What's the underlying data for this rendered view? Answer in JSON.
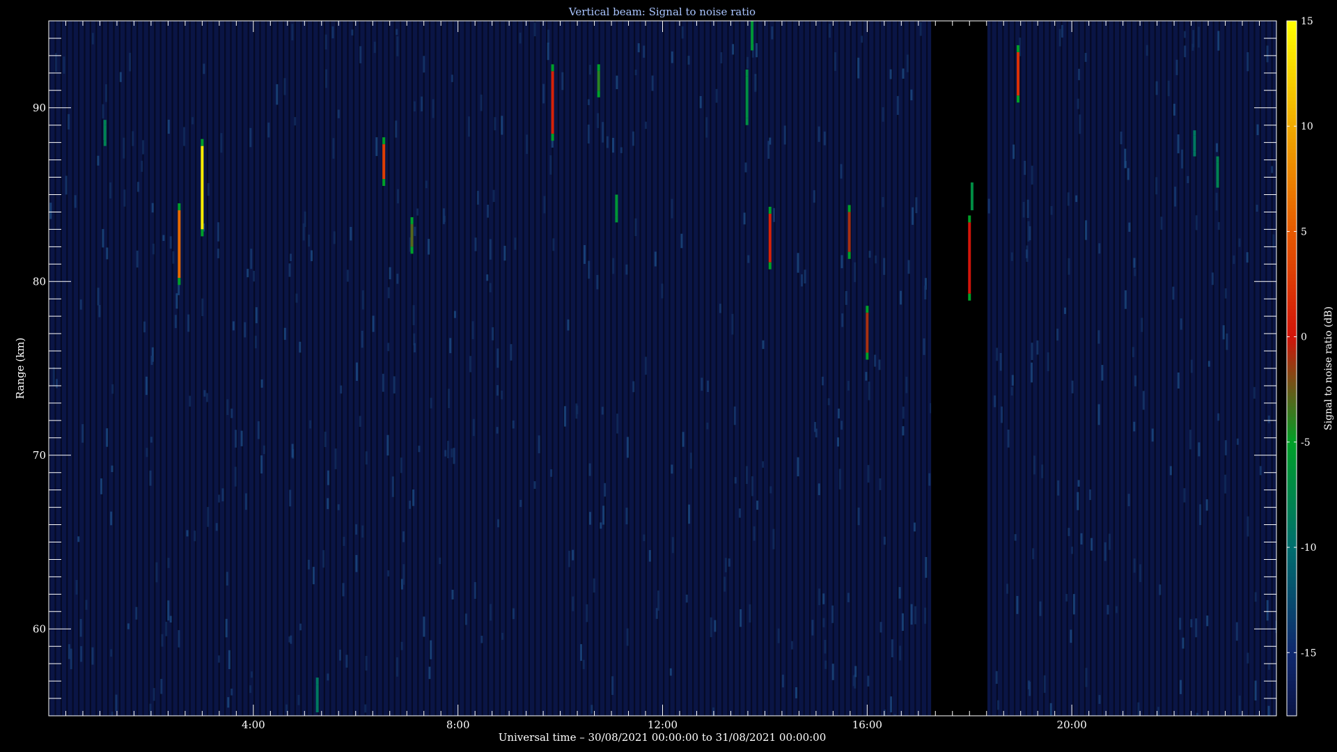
{
  "chart_data": {
    "type": "heatmap",
    "title": "Vertical beam: Signal to noise ratio",
    "xlabel": "Universal time – 30/08/2021 00:00:00 to 31/08/2021 00:00:00",
    "ylabel": "Range (km)",
    "colorbar_label": "Signal to noise ratio (dB)",
    "x_unit": "hours UT",
    "xlim": [
      0,
      24
    ],
    "ylim": [
      55,
      95
    ],
    "clim": [
      -18,
      15
    ],
    "x_ticks": [
      {
        "value": 4,
        "label": "4:00"
      },
      {
        "value": 8,
        "label": "8:00"
      },
      {
        "value": 12,
        "label": "12:00"
      },
      {
        "value": 16,
        "label": "16:00"
      },
      {
        "value": 20,
        "label": "20:00"
      }
    ],
    "y_ticks": [
      {
        "value": 60,
        "label": "60"
      },
      {
        "value": 70,
        "label": "70"
      },
      {
        "value": 80,
        "label": "80"
      },
      {
        "value": 90,
        "label": "90"
      }
    ],
    "colorbar_ticks": [
      {
        "value": 15,
        "label": "15"
      },
      {
        "value": 10,
        "label": "10"
      },
      {
        "value": 5,
        "label": "5"
      },
      {
        "value": 0,
        "label": "0"
      },
      {
        "value": -5,
        "label": "-5"
      },
      {
        "value": -10,
        "label": "-10"
      },
      {
        "value": -15,
        "label": "-15"
      }
    ],
    "background_snr": -16,
    "data_gap": {
      "x_start": 17.25,
      "x_end": 18.35
    },
    "echoes": [
      {
        "x": 1.1,
        "y_start": 87.8,
        "y_end": 89.3,
        "snr": -8
      },
      {
        "x": 2.55,
        "y_start": 79.8,
        "y_end": 84.5,
        "snr": 6
      },
      {
        "x": 3.0,
        "y_start": 82.6,
        "y_end": 88.2,
        "snr": 14
      },
      {
        "x": 5.25,
        "y_start": 55.2,
        "y_end": 57.2,
        "snr": -9
      },
      {
        "x": 6.55,
        "y_start": 85.5,
        "y_end": 88.3,
        "snr": 3
      },
      {
        "x": 7.1,
        "y_start": 81.6,
        "y_end": 83.7,
        "snr": -3
      },
      {
        "x": 9.85,
        "y_start": 88.1,
        "y_end": 92.5,
        "snr": 1
      },
      {
        "x": 10.75,
        "y_start": 90.6,
        "y_end": 92.5,
        "snr": -4
      },
      {
        "x": 11.1,
        "y_start": 83.4,
        "y_end": 85.0,
        "snr": -6
      },
      {
        "x": 13.65,
        "y_start": 89.0,
        "y_end": 92.2,
        "snr": -7
      },
      {
        "x": 13.75,
        "y_start": 93.3,
        "y_end": 95.0,
        "snr": -6
      },
      {
        "x": 14.1,
        "y_start": 80.7,
        "y_end": 84.3,
        "snr": 1
      },
      {
        "x": 15.65,
        "y_start": 81.3,
        "y_end": 84.4,
        "snr": -1
      },
      {
        "x": 16.0,
        "y_start": 75.5,
        "y_end": 78.6,
        "snr": -1
      },
      {
        "x": 18.0,
        "y_start": 78.9,
        "y_end": 83.8,
        "snr": 0
      },
      {
        "x": 18.05,
        "y_start": 84.1,
        "y_end": 85.7,
        "snr": -7
      },
      {
        "x": 18.95,
        "y_start": 90.3,
        "y_end": 93.6,
        "snr": 2
      },
      {
        "x": 22.4,
        "y_start": 87.2,
        "y_end": 88.7,
        "snr": -9
      },
      {
        "x": 22.85,
        "y_start": 85.4,
        "y_end": 87.2,
        "snr": -8
      }
    ]
  }
}
